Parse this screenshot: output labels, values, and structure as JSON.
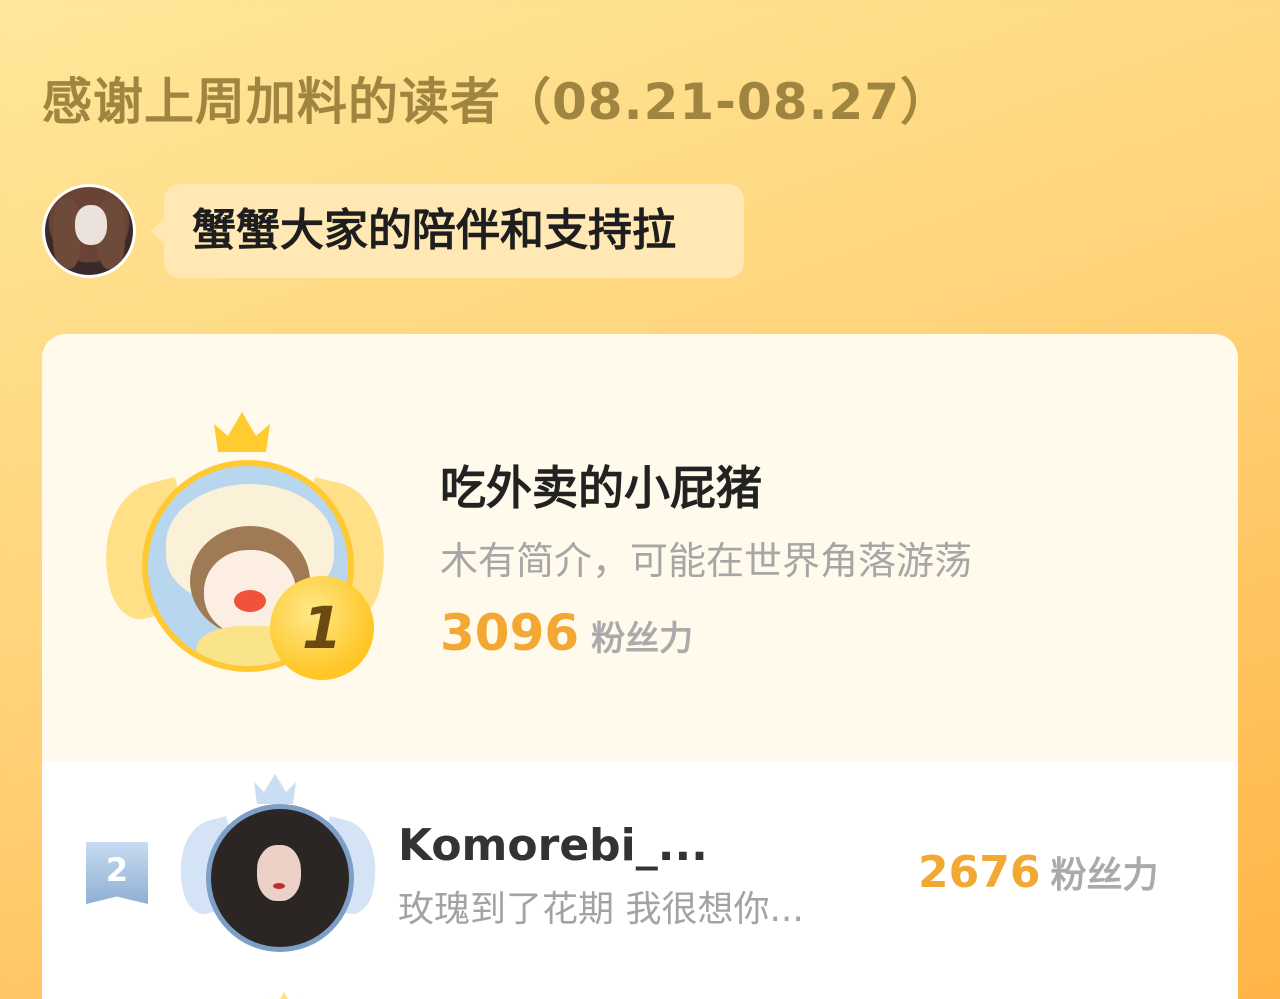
{
  "header": {
    "title": "感谢上周加料的读者（08.21-08.27）"
  },
  "author_message": {
    "text": "蟹蟹大家的陪伴和支持拉"
  },
  "ranking": [
    {
      "rank": "1",
      "name": "吃外卖的小屁猪",
      "intro": "木有简介，可能在世界角落游荡",
      "fans_value": "3096",
      "fans_unit": "粉丝力"
    },
    {
      "rank": "2",
      "name": "Komorebi_...",
      "intro": "玫瑰到了花期 我很想你...",
      "fans_value": "2676",
      "fans_unit": "粉丝力"
    }
  ],
  "colors": {
    "gold": "#ffc624",
    "fans_value": "#f2a833",
    "silver": "#8fb0d4"
  },
  "icons": {
    "crown_gold": "crown-icon",
    "crown_silver": "crown-icon",
    "wing": "wing-decoration"
  }
}
